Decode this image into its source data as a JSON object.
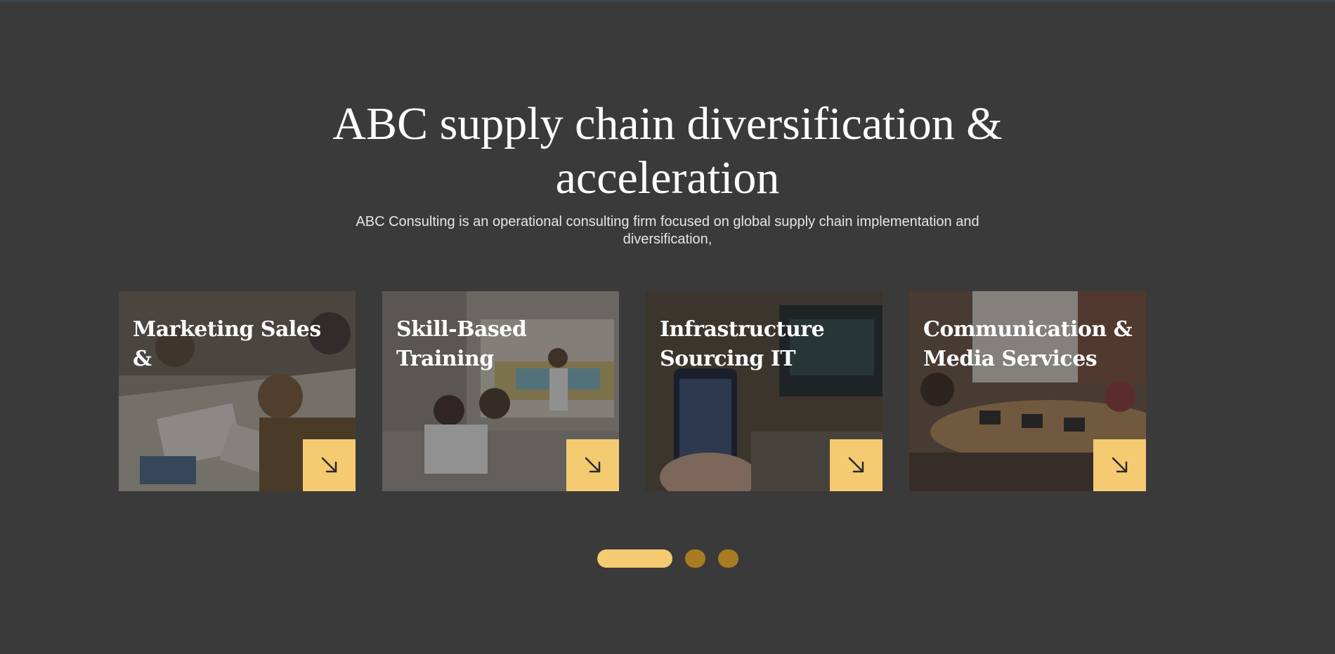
{
  "hero": {
    "title": "ABC supply chain diversification & acceleration",
    "subtitle": "ABC Consulting is an operational consulting firm focused on global supply chain implementation and diversification,"
  },
  "cards": [
    {
      "title": "Marketing Sales &",
      "icon": "arrow-down-right-icon"
    },
    {
      "title": "Skill-Based Training",
      "icon": "arrow-down-right-icon"
    },
    {
      "title": "Infrastructure Sourcing IT",
      "icon": "arrow-down-right-icon"
    },
    {
      "title": "Communication & Media Services",
      "icon": "arrow-down-right-icon"
    }
  ],
  "slider": {
    "active_index": 0,
    "dot_count": 3
  },
  "colors": {
    "background": "#3a3a3a",
    "accent": "#f5cb71",
    "dot_inactive": "#a87c23",
    "text": "#ffffff"
  }
}
